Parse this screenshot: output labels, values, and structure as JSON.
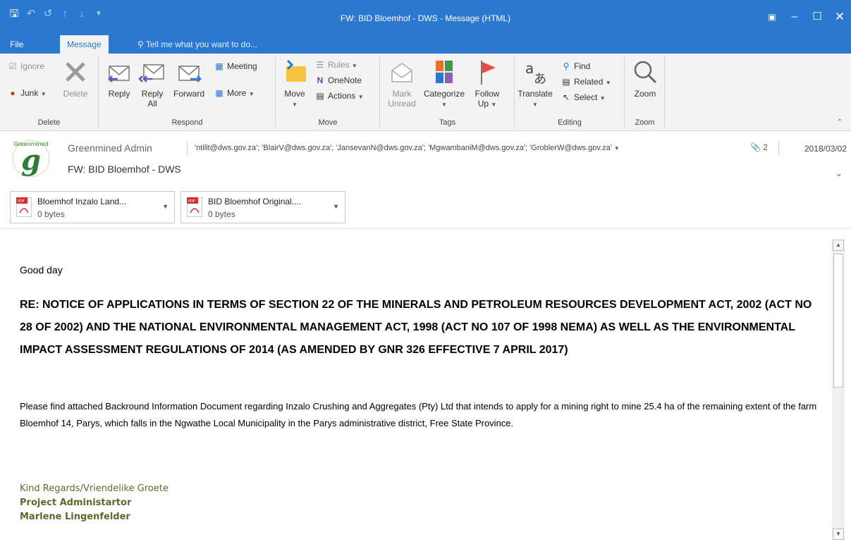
{
  "app": {
    "window_title": "FW: BID Bloemhof - DWS - Message (HTML)"
  },
  "tabs": {
    "file": "File",
    "message": "Message",
    "tell_me": "Tell me what you want to do..."
  },
  "ribbon": {
    "delete_group": {
      "label": "Delete",
      "ignore": "Ignore",
      "junk": "Junk",
      "delete": "Delete"
    },
    "respond_group": {
      "label": "Respond",
      "reply": "Reply",
      "reply_all_1": "Reply",
      "reply_all_2": "All",
      "forward": "Forward",
      "meeting": "Meeting",
      "more": "More"
    },
    "move_group": {
      "label": "Move",
      "move": "Move",
      "rules": "Rules",
      "onenote": "OneNote",
      "actions": "Actions"
    },
    "tags_group": {
      "label": "Tags",
      "mark_unread_1": "Mark",
      "mark_unread_2": "Unread",
      "categorize": "Categorize",
      "follow_up_1": "Follow",
      "follow_up_2": "Up"
    },
    "editing_group": {
      "label": "Editing",
      "translate": "Translate",
      "find": "Find",
      "related": "Related",
      "select": "Select"
    },
    "zoom_group": {
      "label": "Zoom",
      "zoom": "Zoom"
    }
  },
  "header": {
    "sender": "Greenmined Admin",
    "recipients": "'ntilit@dws.gov.za'; 'BlairV@dws.gov.za'; 'JansevanN@dws.gov.za'; 'MgwambaniM@dws.gov.za'; 'GroblerW@dws.gov.za'",
    "attachment_count": "2",
    "date": "2018/03/02",
    "subject": "FW: BID Bloemhof - DWS",
    "logo_text": "Greenmined"
  },
  "attachments": [
    {
      "name": "Bloemhof Inzalo Land...",
      "size": "0 bytes"
    },
    {
      "name": "BID Bloemhof Original....",
      "size": "0 bytes"
    }
  ],
  "body": {
    "greeting": "Good day",
    "heading": "RE: NOTICE OF APPLICATIONS IN TERMS OF SECTION 22 OF THE MINERALS AND PETROLEUM RESOURCES DEVELOPMENT ACT, 2002 (ACT NO 28 OF 2002) AND THE NATIONAL ENVIRONMENTAL MANAGEMENT ACT, 1998 (ACT NO 107 OF 1998 NEMA) AS WELL AS THE ENVIRONMENTAL IMPACT ASSESSMENT REGULATIONS OF 2014 (AS AMENDED BY GNR 326 EFFECTIVE 7 APRIL 2017)",
    "paragraph": "Please find attached Backround Information Document regarding Inzalo Crushing and Aggregates (Pty) Ltd that intends to apply for a mining right to mine 25.4 ha of the remaining extent of the farm Bloemhof 14, Parys, which falls in the Ngwathe Local Municipality in the Parys administrative district, Free State Province.",
    "signature_1": "Kind Regards/Vriendelike Groete",
    "signature_2": "Project Administartor",
    "signature_3": "Marlene Lingenfelder"
  },
  "colors": {
    "accent": "#2b78d1",
    "ribbon_bg": "#f3f3f3",
    "signature": "#5a6b2d"
  }
}
